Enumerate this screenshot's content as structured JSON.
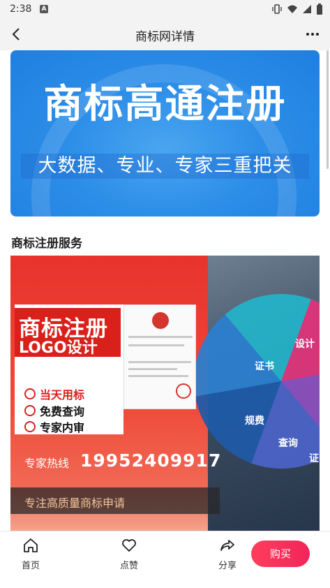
{
  "status_bar": {
    "time": "2:38",
    "notification_letter": "A",
    "icons": [
      "vibrate-icon",
      "wifi-icon",
      "signal-icon",
      "battery-icon"
    ]
  },
  "header": {
    "title": "商标网详情",
    "back_icon": "chevron-left-icon",
    "more_icon": "more-dots-icon"
  },
  "hero_banner": {
    "title": "商标高通注册",
    "subtitle": "大数据、专业、专家三重把关",
    "colors": {
      "background": "#2d8ee8",
      "text": "#ffffff"
    }
  },
  "section": {
    "title": "商标注册服务"
  },
  "promo_image": {
    "headline": "商标注册",
    "logo_line": "LOGO设计",
    "features": [
      {
        "label": "当天用标",
        "icon": "search-icon"
      },
      {
        "label": "免费查询",
        "icon": "user-icon"
      },
      {
        "label": "专家内审",
        "icon": "check-shield-icon"
      }
    ],
    "hotline_label": "专家热线",
    "hotline_number": "19952409917",
    "slogan": "专注高质量商标申请",
    "fan_labels": [
      "证书",
      "设计",
      "规费",
      "查询",
      "证"
    ],
    "colors": {
      "background": "#e8332c",
      "accent": "#d9201b"
    }
  },
  "bottom_bar": {
    "home_label": "首页",
    "like_label": "点赞",
    "share_label": "分享",
    "buy_label": "购买",
    "colors": {
      "buy_button": "#f2245a"
    }
  }
}
